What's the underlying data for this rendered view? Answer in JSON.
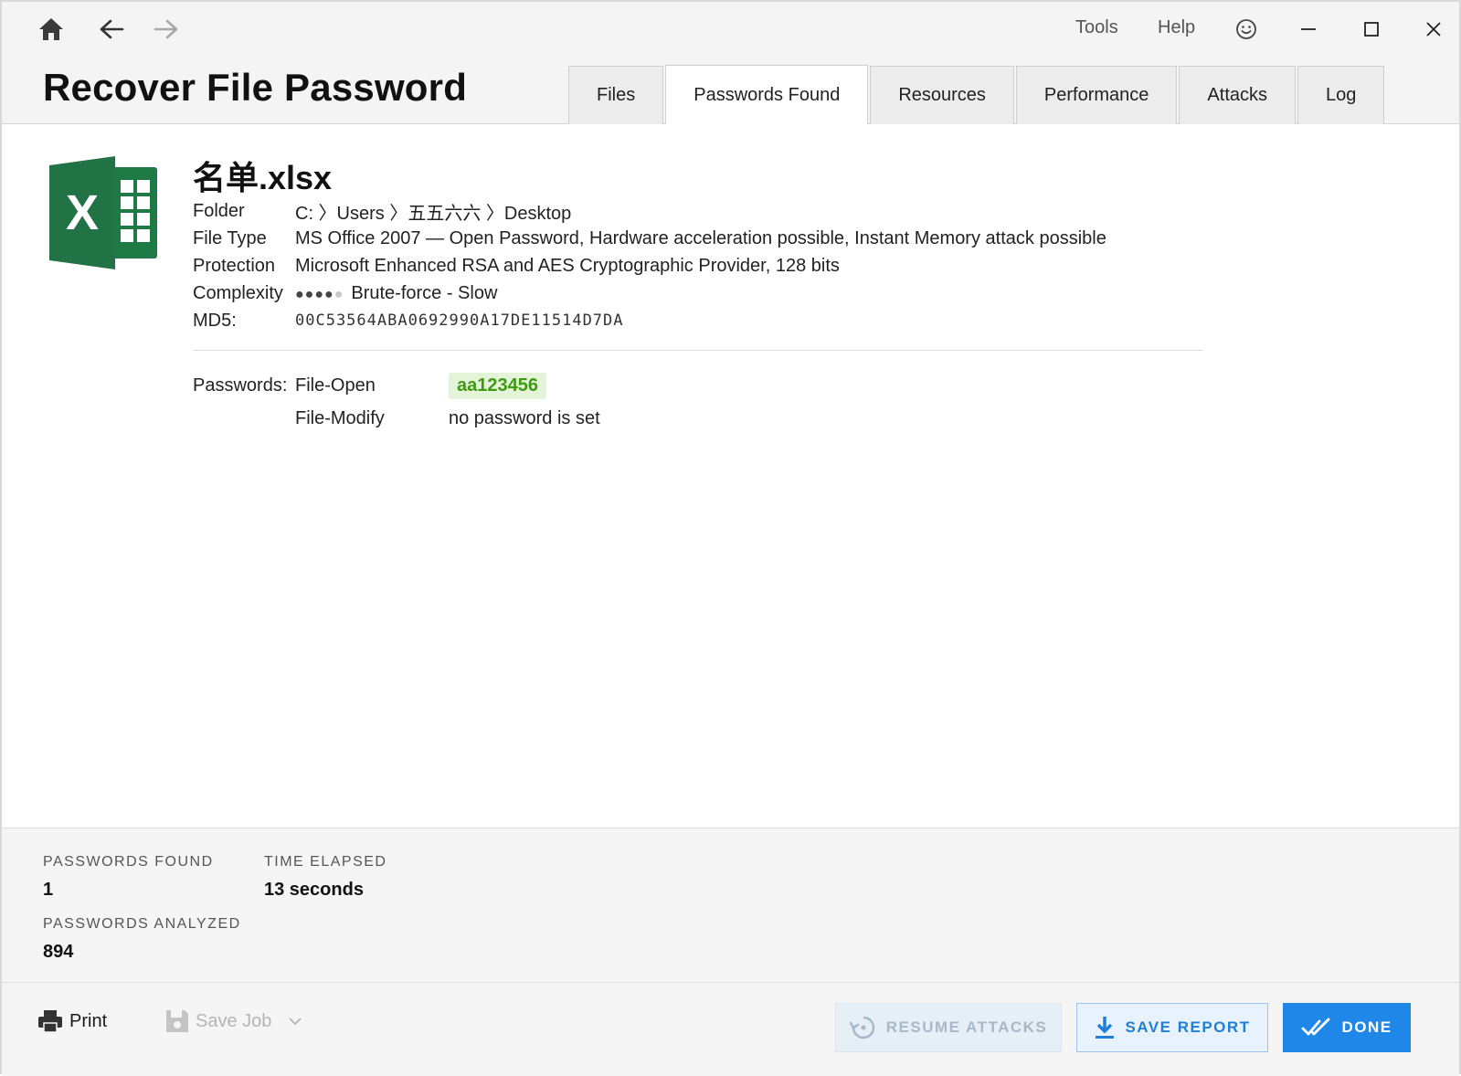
{
  "window": {
    "menu": {
      "tools": "Tools",
      "help": "Help"
    },
    "icons": {
      "home": "home-icon",
      "back": "arrow-left-icon",
      "forward": "arrow-right-icon",
      "feedback": "smiley-icon",
      "minimize": "minimize-icon",
      "maximize": "maximize-icon",
      "close": "close-icon"
    }
  },
  "header": {
    "title": "Recover File Password"
  },
  "tabs": [
    {
      "label": "Files"
    },
    {
      "label": "Passwords Found"
    },
    {
      "label": "Resources"
    },
    {
      "label": "Performance"
    },
    {
      "label": "Attacks"
    },
    {
      "label": "Log"
    }
  ],
  "active_tab": "Passwords Found",
  "file": {
    "name": "名单.xlsx",
    "icon": "excel-file-icon",
    "folder_label": "Folder",
    "folder_value": "C: 〉Users 〉五五六六 〉Desktop",
    "type_label": "File Type",
    "type_value": "MS Office 2007 — Open Password, Hardware acceleration possible, Instant Memory attack possible",
    "protection_label": "Protection",
    "protection_value": "Microsoft Enhanced RSA and AES Cryptographic Provider, 128 bits",
    "complexity_label": "Complexity",
    "complexity_level": 4,
    "complexity_max": 5,
    "complexity_value": "Brute-force - Slow",
    "md5_label": "MD5:",
    "md5_value": "00C53564ABA0692990A17DE11514D7DA"
  },
  "passwords": {
    "label": "Passwords:",
    "rows": [
      {
        "type": "File-Open",
        "value": "aa123456",
        "found": true
      },
      {
        "type": "File-Modify",
        "value": "no password is set",
        "found": false
      }
    ]
  },
  "stats": {
    "found_label": "PASSWORDS FOUND",
    "found_value": "1",
    "elapsed_label": "TIME ELAPSED",
    "elapsed_value": "13 seconds",
    "analyzed_label": "PASSWORDS ANALYZED",
    "analyzed_value": "894"
  },
  "footer": {
    "print": "Print",
    "save_job": "Save Job",
    "resume": "RESUME ATTACKS",
    "save_report": "SAVE REPORT",
    "done": "DONE"
  },
  "colors": {
    "accent": "#1f87e8",
    "password_found_bg": "#e3f4d8",
    "password_found_text": "#3e9a12",
    "excel_green": "#1e7a45"
  }
}
